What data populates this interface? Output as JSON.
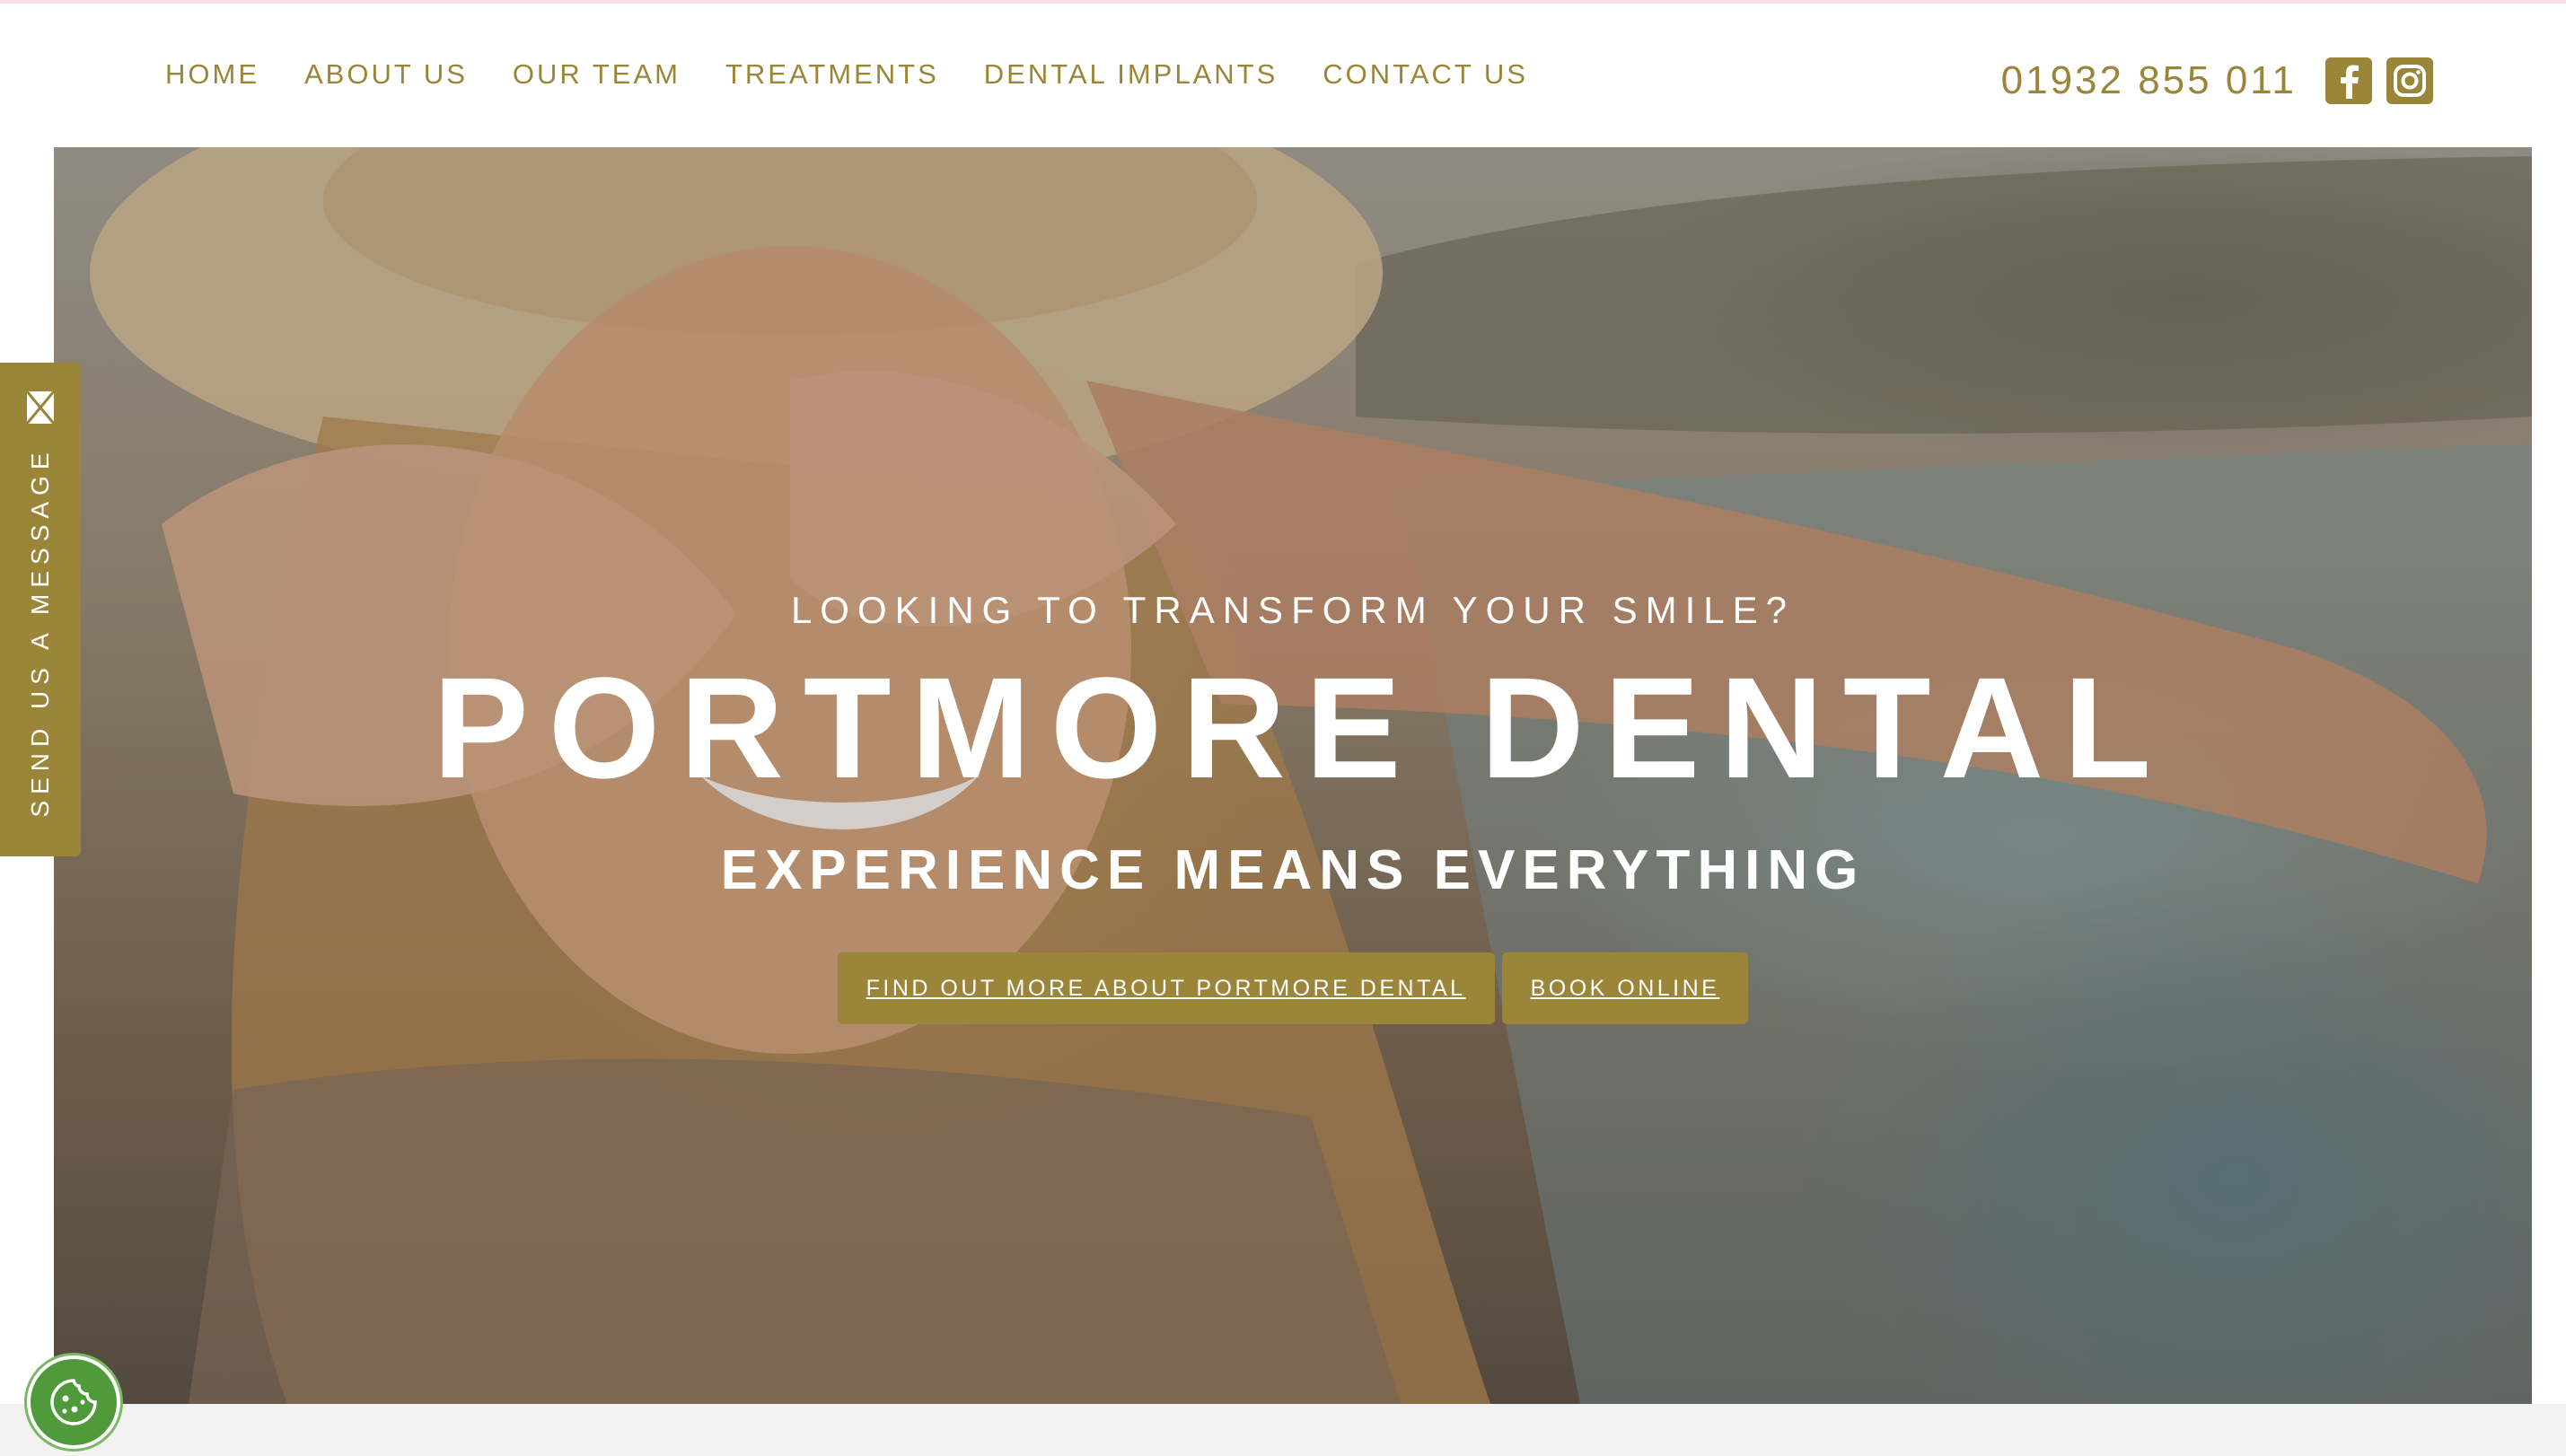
{
  "nav": {
    "items": [
      {
        "label": "HOME"
      },
      {
        "label": "ABOUT US"
      },
      {
        "label": "OUR TEAM"
      },
      {
        "label": "TREATMENTS"
      },
      {
        "label": "DENTAL IMPLANTS"
      },
      {
        "label": "CONTACT US"
      }
    ]
  },
  "contact": {
    "phone": "01932 855 011",
    "social": [
      {
        "icon": "facebook-icon"
      },
      {
        "icon": "instagram-icon"
      }
    ]
  },
  "hero": {
    "kicker": "LOOKING TO TRANSFORM YOUR SMILE?",
    "title": "PORTMORE DENTAL",
    "subtitle": "EXPERIENCE MEANS EVERYTHING",
    "buttons": [
      {
        "label": "FIND OUT MORE ABOUT PORTMORE DENTAL"
      },
      {
        "label": "BOOK ONLINE"
      }
    ]
  },
  "side_tab": {
    "label": "SEND US A MESSAGE",
    "icon": "envelope-icon"
  },
  "cookie": {
    "icon": "cookie-icon"
  },
  "colors": {
    "accent": "#9b8538",
    "text_on_hero": "#ffffff",
    "cookie_green": "#4f9a3a"
  }
}
